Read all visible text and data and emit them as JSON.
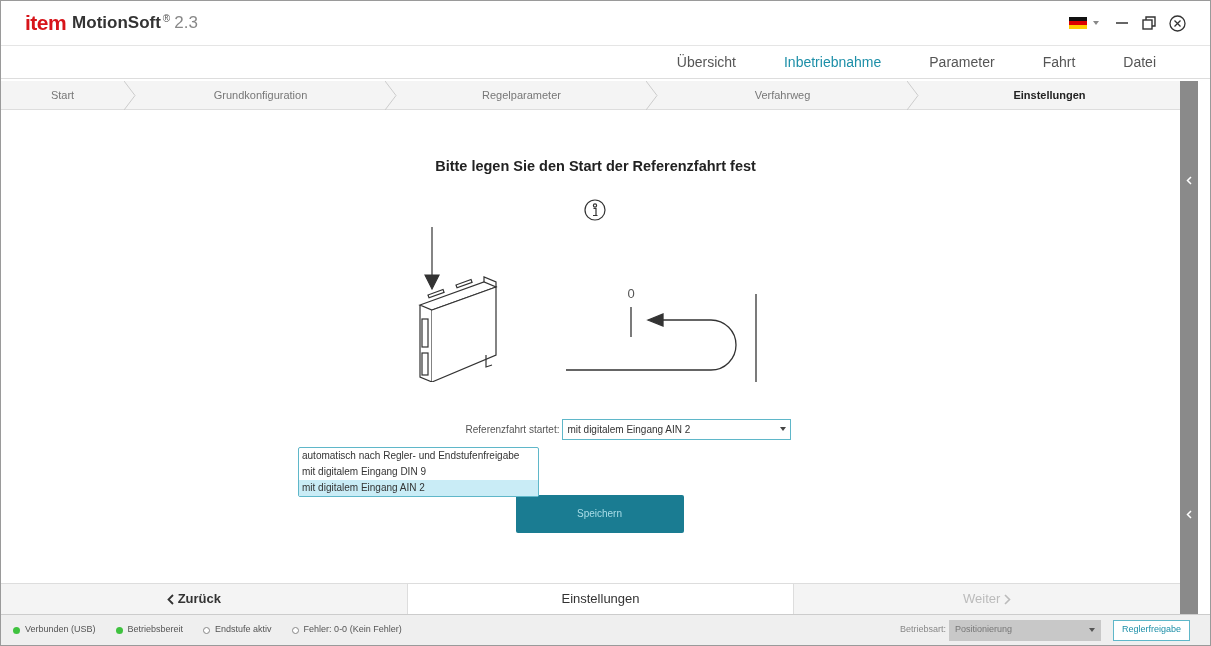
{
  "window": {
    "brand": "item",
    "title": "MotionSoft",
    "superscript": "®",
    "version": "2.3"
  },
  "menu": [
    {
      "label": "Übersicht",
      "selected": false
    },
    {
      "label": "Inbetriebnahme",
      "selected": true
    },
    {
      "label": "Parameter",
      "selected": false
    },
    {
      "label": "Fahrt",
      "selected": false
    },
    {
      "label": "Datei",
      "selected": false
    }
  ],
  "steps": [
    {
      "label": "Start",
      "selected": false
    },
    {
      "label": "Grundkonfiguration",
      "selected": false
    },
    {
      "label": "Regelparameter",
      "selected": false
    },
    {
      "label": "Verfahrweg",
      "selected": false
    },
    {
      "label": "Einstellungen",
      "selected": true
    }
  ],
  "heading": "Bitte legen Sie den Start der Referenzfahrt fest",
  "diagram": {
    "zero_label": "0"
  },
  "form": {
    "label": "Referenzfahrt startet:",
    "value": "mit digitalem Eingang AIN 2",
    "expanded": true,
    "options": [
      {
        "label": "automatisch nach Regler- und Endstufenfreigabe",
        "selected": false
      },
      {
        "label": "mit digitalem Eingang DIN 9",
        "selected": false
      },
      {
        "label": "mit digitalem Eingang AIN 2",
        "selected": true
      }
    ]
  },
  "save_button": "Speichern",
  "nav": {
    "back": "Zurück",
    "current": "Einstellungen",
    "next": "Weiter",
    "next_disabled": true
  },
  "status": [
    {
      "label": "Verbunden (USB)",
      "on": true
    },
    {
      "label": "Betriebsbereit",
      "on": true
    },
    {
      "label": "Endstufe aktiv",
      "on": false
    },
    {
      "label": "Fehler: 0-0 (Kein Fehler)",
      "on": false
    }
  ],
  "mode": {
    "label": "Betriebsart:",
    "value": "Positionierung"
  },
  "enable_button": "Reglerfreigabe"
}
